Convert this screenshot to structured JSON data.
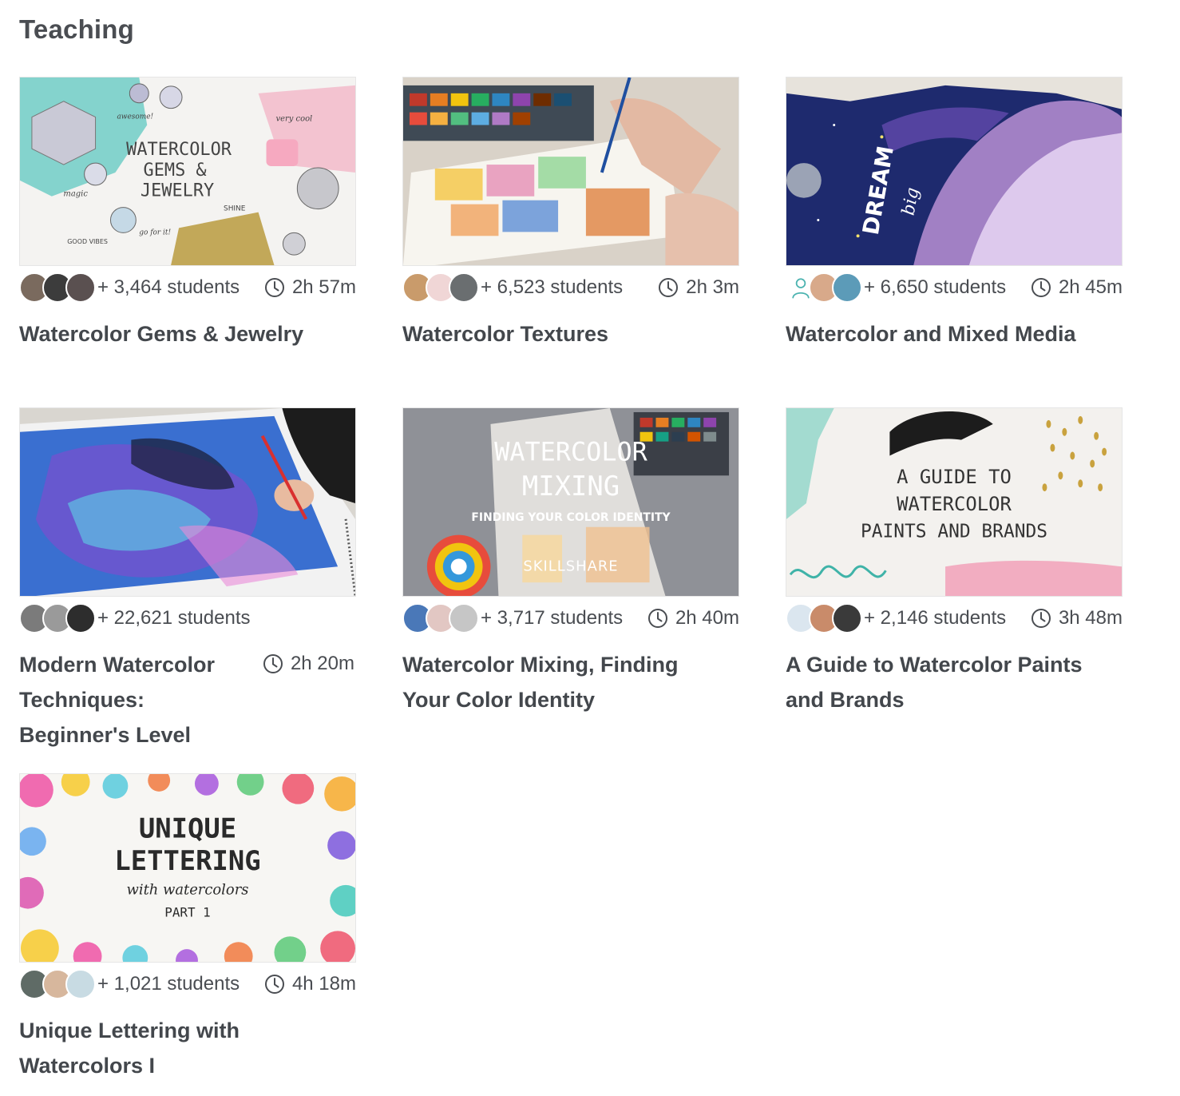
{
  "section": {
    "title": "Teaching"
  },
  "icons": {
    "clock": "clock-icon",
    "student_avatar": "avatar"
  },
  "colors": {
    "text": "#43474c",
    "muted": "#4a4d52"
  },
  "courses": [
    {
      "title": "Watercolor Gems & Jewelry",
      "students": "+ 3,464 students",
      "duration": "2h 57m",
      "thumbnail_text": [
        "WATERCOLOR",
        "GEMS &",
        "JEWELRY",
        "very cool",
        "awesome!",
        "magic",
        "GOOD VIBES",
        "go for it!",
        "SHINE"
      ]
    },
    {
      "title": "Watercolor Textures",
      "students": "+ 6,523 students",
      "duration": "2h 3m",
      "thumbnail_text": []
    },
    {
      "title": "Watercolor and Mixed Media",
      "students": "+ 6,650 students",
      "duration": "2h 45m",
      "thumbnail_text": [
        "DREAM",
        "big"
      ]
    },
    {
      "title": "Modern Watercolor Techniques: Beginner's Level",
      "students": "+ 22,621 students",
      "duration": "2h 20m",
      "thumbnail_text": []
    },
    {
      "title": "Watercolor Mixing, Finding Your Color Identity",
      "students": "+ 3,717 students",
      "duration": "2h 40m",
      "thumbnail_text": [
        "WATERCOLOR",
        "MIXING",
        "FINDING YOUR COLOR IDENTITY",
        "SKILLSHARE"
      ]
    },
    {
      "title": "A Guide to Watercolor Paints and Brands",
      "students": "+ 2,146 students",
      "duration": "3h 48m",
      "thumbnail_text": [
        "A GUIDE TO",
        "WATERCOLOR",
        "PAINTS AND BRANDS"
      ]
    },
    {
      "title": "Unique Lettering with Watercolors I",
      "students": "+ 1,021 students",
      "duration": "4h 18m",
      "thumbnail_text": [
        "UNIQUE",
        "LETTERING",
        "with watercolors",
        "PART 1"
      ]
    }
  ]
}
